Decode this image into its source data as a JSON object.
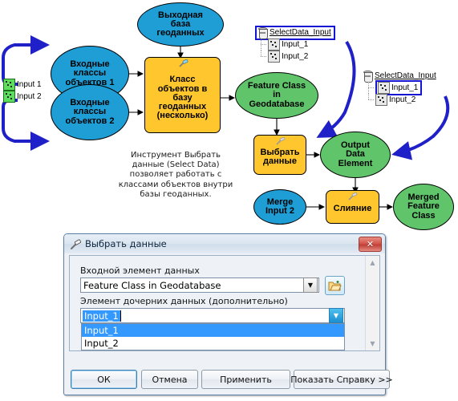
{
  "diagram": {
    "nodes": [
      {
        "id": "input_fc_1",
        "label": "Входные\nклассы\nобъектов 1",
        "shape": "ellipse",
        "color": "#1f9ed6"
      },
      {
        "id": "input_fc_2",
        "label": "Входные\nклассы\nобъектов 2",
        "shape": "ellipse",
        "color": "#1f9ed6"
      },
      {
        "id": "output_gdb",
        "label": "Выходная\nбаза\nгеоданных",
        "shape": "ellipse",
        "color": "#1f9ed6"
      },
      {
        "id": "fc_to_gdb_tool",
        "label": "Класс\nобъектов в\nбазу\nгеоданных\n(несколько)",
        "shape": "tool",
        "color": "#ffc62e"
      },
      {
        "id": "feature_class_in_gdb",
        "label": "Feature Class\nin\nGeodatabase",
        "shape": "ellipse",
        "color": "#5fc46a"
      },
      {
        "id": "select_data_tool",
        "label": "Выбрать\nданные",
        "shape": "tool",
        "color": "#ffc62e"
      },
      {
        "id": "output_data_element",
        "label": "Output\nData\nElement",
        "shape": "ellipse",
        "color": "#5fc46a"
      },
      {
        "id": "merge_input_2",
        "label": "Merge\nInput 2",
        "shape": "ellipse",
        "color": "#1f9ed6"
      },
      {
        "id": "merge_tool",
        "label": "Слияние",
        "shape": "tool",
        "color": "#ffc62e"
      },
      {
        "id": "merged_feature_class",
        "label": "Merged\nFeature\nClass",
        "shape": "ellipse",
        "color": "#5fc46a"
      }
    ],
    "left_inputs": [
      {
        "label": "Input 1",
        "icon": "feature-class-icon"
      },
      {
        "label": "Input 2",
        "icon": "feature-class-icon"
      }
    ],
    "tree_top": {
      "root": {
        "label": "SelectData_Input",
        "icon": "geodatabase-icon",
        "selected": true
      },
      "children": [
        {
          "label": "Input_1",
          "icon": "feature-class-icon",
          "selected": false
        },
        {
          "label": "Input_2",
          "icon": "feature-class-icon",
          "selected": false
        }
      ]
    },
    "tree_right": {
      "root": {
        "label": "SelectData_Input",
        "icon": "geodatabase-icon",
        "selected": false
      },
      "children": [
        {
          "label": "Input_1",
          "icon": "feature-class-icon",
          "selected": true
        },
        {
          "label": "Input_2",
          "icon": "feature-class-icon",
          "selected": false
        }
      ]
    },
    "annotation": "Инструмент Выбрать\nданные (Select Data)\nпозволяет работать с\nклассами объектов внутри\nбазы геоданных.",
    "colors": {
      "variable_blue": "#1f9ed6",
      "derived_green": "#5fc46a",
      "tool_yellow": "#ffc62e",
      "connector_blue": "#2020c8",
      "selection_blue": "#1414d2"
    }
  },
  "dialog": {
    "title": "Выбрать данные",
    "title_icon": "hammer-icon",
    "close_label": "✕",
    "input_label": "Входной элемент данных",
    "input_value": "Feature Class in Geodatabase",
    "browse_icon": "open-folder-icon",
    "child_label": "Элемент дочерних данных (дополнительно)",
    "child_value": "Input_1",
    "dropdown_options": [
      "Input_1",
      "Input_2"
    ],
    "dropdown_selected": "Input_1",
    "buttons": {
      "ok": "ОК",
      "cancel": "Отмена",
      "apply": "Применить",
      "help": "Показать Справку >>"
    },
    "scrollbar": {
      "up": "▲",
      "down": "▼"
    }
  }
}
